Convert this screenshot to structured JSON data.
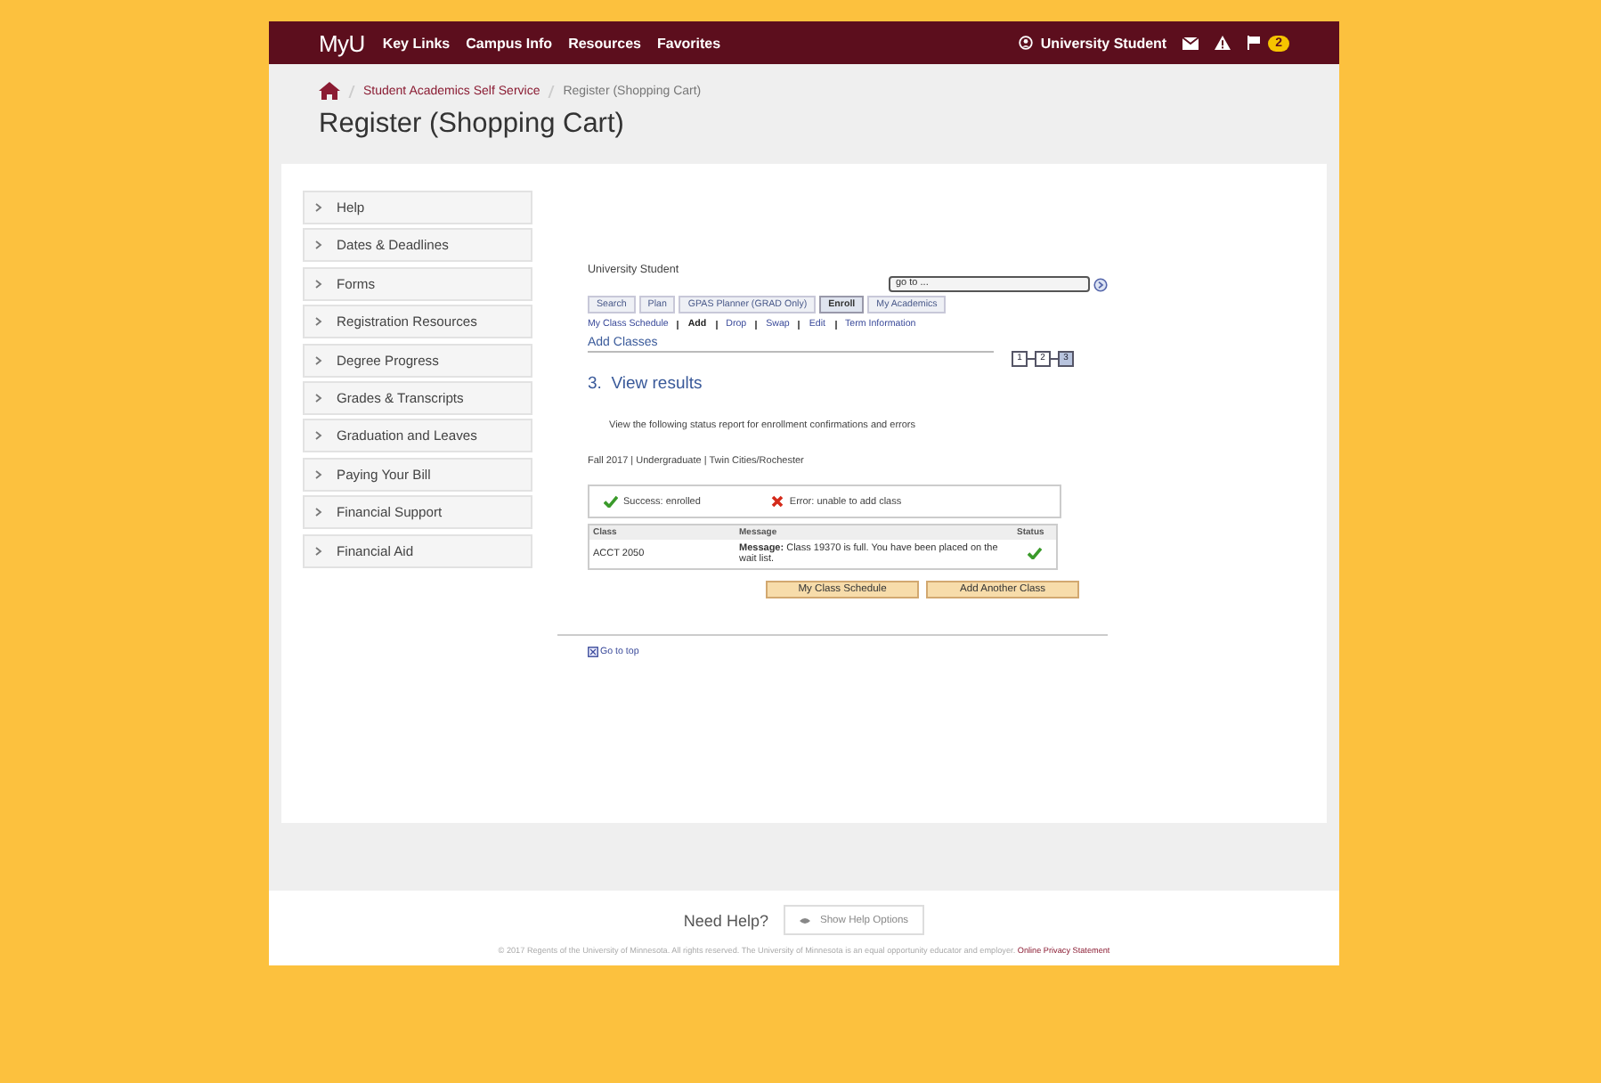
{
  "topbar": {
    "logo": "MyU",
    "nav": [
      "Key Links",
      "Campus Info",
      "Resources",
      "Favorites"
    ],
    "user": "University Student",
    "badge": "2"
  },
  "breadcrumb": [
    "Student Academics Self Service",
    "Register (Shopping Cart)"
  ],
  "title": "Register (Shopping Cart)",
  "sidebar": {
    "items": [
      "Help",
      "Dates & Deadlines",
      "Forms",
      "Registration Resources",
      "Degree Progress",
      "Grades & Transcripts",
      "Graduation and Leaves",
      "Paying Your Bill",
      "Financial Support",
      "Financial Aid"
    ]
  },
  "enroll": {
    "student": "University Student",
    "goto": "go to ...",
    "tabs": [
      {
        "label": "Search",
        "selected": false
      },
      {
        "label": "Plan",
        "selected": false
      },
      {
        "label": "GPAS Planner (GRAD Only)",
        "selected": false
      },
      {
        "label": "Enroll",
        "selected": true
      },
      {
        "label": "My Academics",
        "selected": false
      }
    ],
    "links": [
      {
        "label": "My Class Schedule",
        "selected": false
      },
      {
        "label": "Add",
        "selected": true
      },
      {
        "label": "Drop",
        "selected": false
      },
      {
        "label": "Swap",
        "selected": false
      },
      {
        "label": "Edit",
        "selected": false
      },
      {
        "label": "Term Information",
        "selected": false
      }
    ],
    "section": "Add Classes",
    "steps": [
      {
        "label": "1",
        "selected": false
      },
      {
        "label": "2",
        "selected": false
      },
      {
        "label": "3",
        "selected": true
      }
    ],
    "heading": "3.  View results",
    "instructions": "View the following status report for enrollment confirmations and errors",
    "term": "Fall 2017 | Undergraduate | Twin Cities/Rochester",
    "legend": [
      {
        "kind": "success",
        "label": "Success: enrolled"
      },
      {
        "kind": "error",
        "label": "Error: unable to add class"
      }
    ],
    "table": {
      "columns": [
        "Class",
        "Message",
        "Status"
      ],
      "rows": [
        {
          "class": "ACCT 2050",
          "message": "**Message:** Class 19370 is full. You have been placed on the wait list.",
          "kind": "success"
        }
      ]
    },
    "buttons": [
      "My Class Schedule",
      "Add Another Class"
    ],
    "go_to_top": "Go to top"
  },
  "footer": {
    "need_help": "Need Help?",
    "help_button": "Show Help Options",
    "copyright": "© 2017 Regents of the University of Minnesota. All rights reserved. The University of Minnesota is an equal opportunity educator and employer.",
    "privacy_link": "Online Privacy Statement"
  }
}
